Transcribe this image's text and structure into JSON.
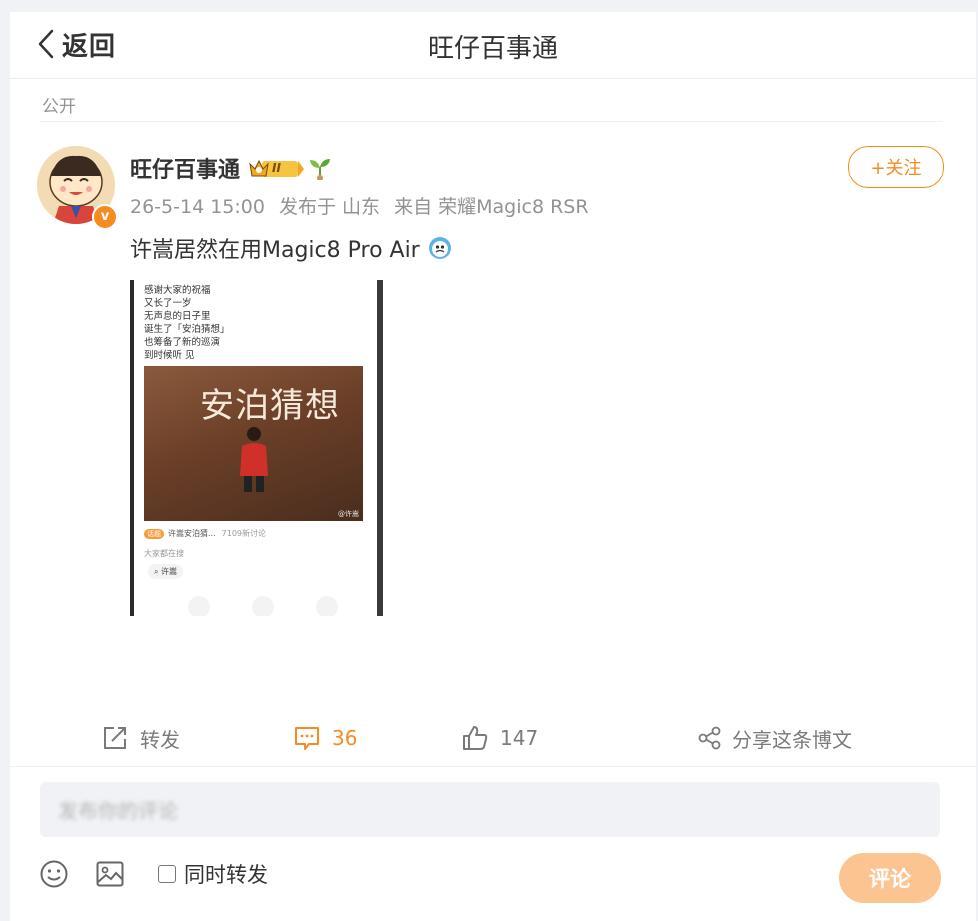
{
  "header": {
    "back_label": "返回",
    "title": "旺仔百事通"
  },
  "post": {
    "visibility": "公开",
    "author": {
      "name": "旺仔百事通",
      "vip_level": "II",
      "verified_mark": "v"
    },
    "follow_label": "+关注",
    "meta": {
      "time": "26-5-14 15:00",
      "location": "发布于 山东",
      "source": "来自 荣耀Magic8 RSR"
    },
    "text": "许嵩居然在用Magic8 Pro Air",
    "image": {
      "lines": [
        "感谢大家的祝福",
        "又长了一岁",
        "无声息的日子里",
        "诞生了「安泊猜想」",
        "也筹备了新的巡演",
        "到时候听 见"
      ],
      "photo_title": "安泊猜想",
      "photo_caption": "@许嵩",
      "topic_tag": "话题",
      "topic_text": "许嵩安泊猜...",
      "topic_count": "7109新讨论",
      "subhead": "大家都在搜",
      "search_term": "许嵩"
    }
  },
  "actions": {
    "repost_label": "转发",
    "comment_count": "36",
    "like_count": "147",
    "share_label": "分享这条博文"
  },
  "composer": {
    "input_text": "发布你的评论",
    "repost_checkbox_label": "同时转发",
    "submit_label": "评论"
  },
  "colors": {
    "accent": "#f78b1f",
    "submit_disabled": "#fbc491",
    "page_bg": "#f1f2f5"
  },
  "icons": [
    "chevron-left-icon",
    "crown-icon",
    "sprout-icon",
    "emoji-icon",
    "repost-icon",
    "comment-icon",
    "like-icon",
    "share-icon",
    "smile-icon",
    "image-icon",
    "verified-icon"
  ]
}
